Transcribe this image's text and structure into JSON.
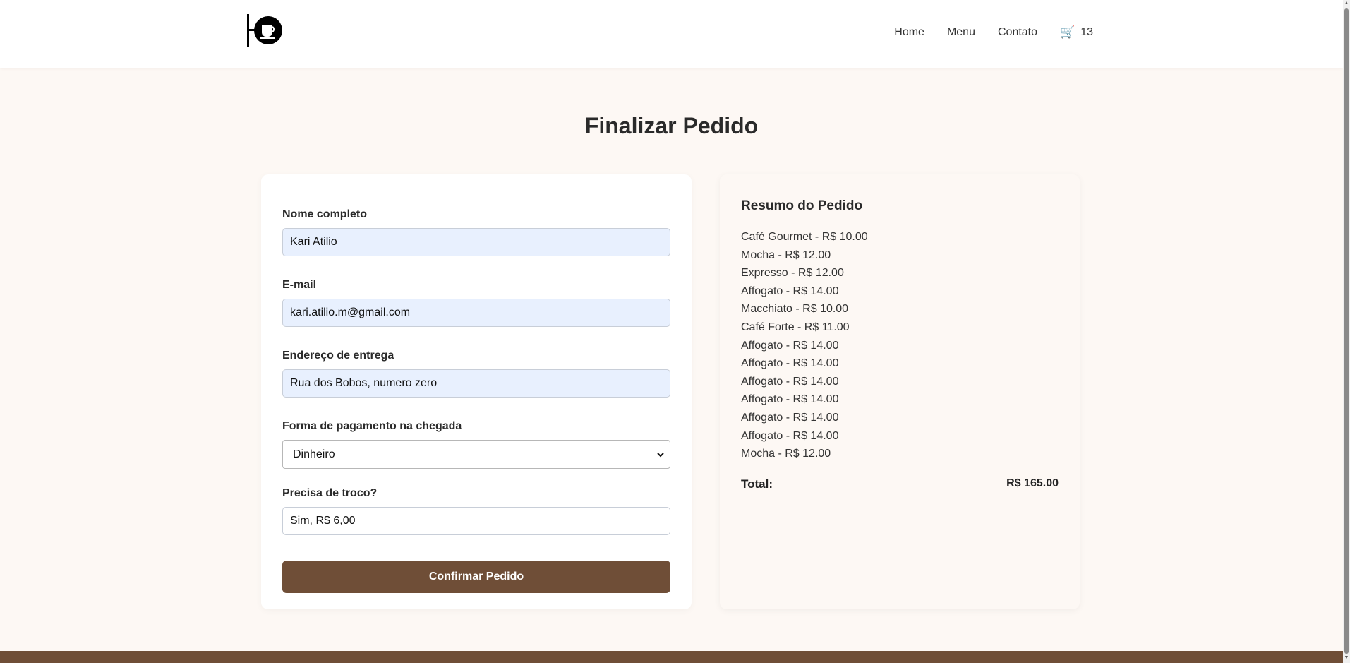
{
  "header": {
    "logo_icon": "coffee-sign-icon",
    "nav": [
      {
        "label": "Home"
      },
      {
        "label": "Menu"
      },
      {
        "label": "Contato"
      }
    ],
    "cart": {
      "icon": "cart-icon",
      "count": "13"
    }
  },
  "page_title": "Finalizar Pedido",
  "form": {
    "name": {
      "label": "Nome completo",
      "value": "Kari Atilio"
    },
    "email": {
      "label": "E-mail",
      "value": "kari.atilio.m@gmail.com"
    },
    "address": {
      "label": "Endereço de entrega",
      "value": "Rua dos Bobos, numero zero"
    },
    "payment": {
      "label": "Forma de pagamento na chegada",
      "selected": "Dinheiro"
    },
    "change": {
      "label": "Precisa de troco?",
      "value": "Sim, R$ 6,00"
    },
    "confirm_label": "Confirmar Pedido"
  },
  "summary": {
    "title": "Resumo do Pedido",
    "items": [
      "Café Gourmet - R$ 10.00",
      "Mocha - R$ 12.00",
      "Expresso - R$ 12.00",
      "Affogato - R$ 14.00",
      "Macchiato - R$ 10.00",
      "Café Forte - R$ 11.00",
      "Affogato - R$ 14.00",
      "Affogato - R$ 14.00",
      "Affogato - R$ 14.00",
      "Affogato - R$ 14.00",
      "Affogato - R$ 14.00",
      "Affogato - R$ 14.00",
      "Mocha - R$ 12.00"
    ],
    "total_label": "Total:",
    "total_value": "R$ 165.00"
  },
  "colors": {
    "accent": "#6f4e37",
    "background": "#fdf8f4",
    "autofill": "#e8f0fe"
  }
}
